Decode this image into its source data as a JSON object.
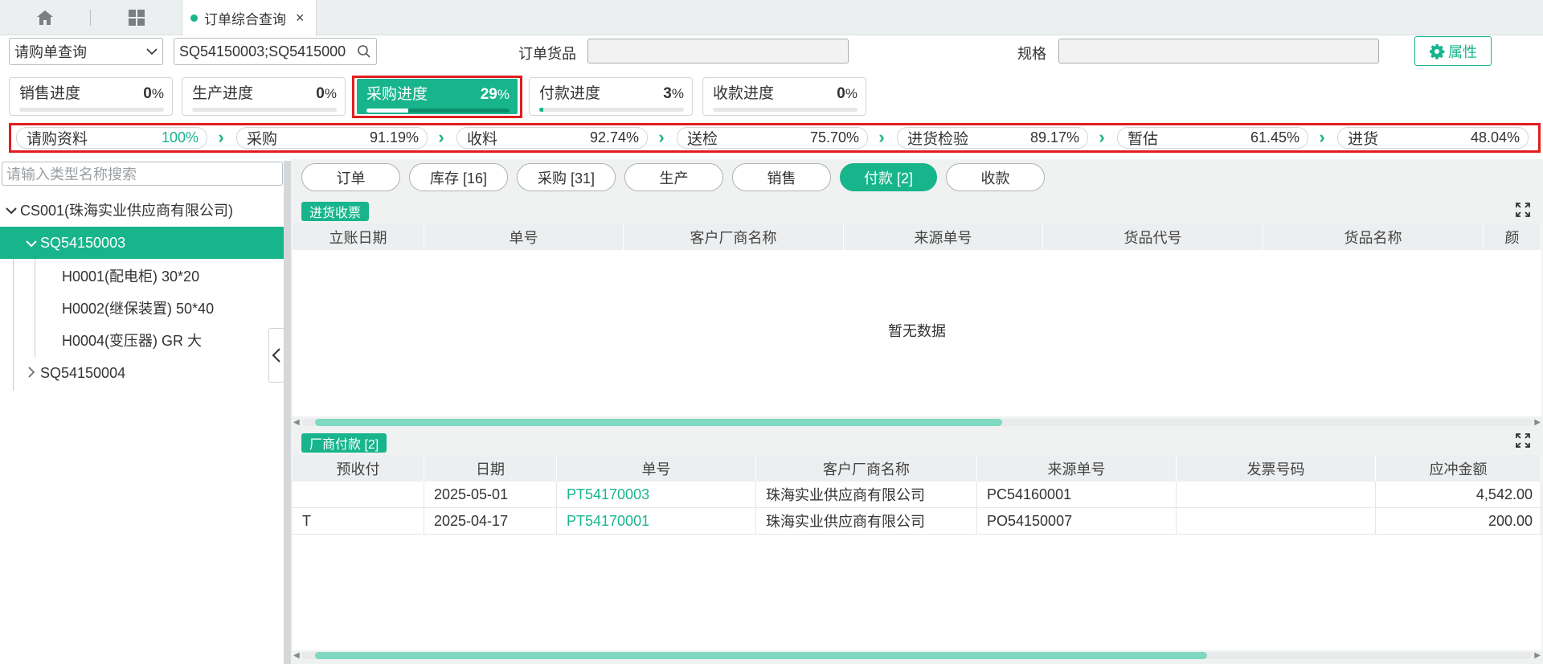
{
  "tabs": {
    "active_title": "订单综合查询",
    "close": "×"
  },
  "query": {
    "type_select": "请购单查询",
    "search_value": "SQ54150003;SQ5415000",
    "goods_label": "订单货品",
    "spec_label": "规格",
    "attr_button": "属性"
  },
  "progress": [
    {
      "label": "销售进度",
      "num": "0",
      "unit": "%",
      "value": 0
    },
    {
      "label": "生产进度",
      "num": "0",
      "unit": "%",
      "value": 0
    },
    {
      "label": "采购进度",
      "num": "29",
      "unit": "%",
      "value": 29
    },
    {
      "label": "付款进度",
      "num": "3",
      "unit": "%",
      "value": 3
    },
    {
      "label": "收款进度",
      "num": "0",
      "unit": "%",
      "value": 0
    }
  ],
  "steps": [
    {
      "label": "请购资料",
      "value": "100%"
    },
    {
      "label": "采购",
      "value": "91.19%"
    },
    {
      "label": "收料",
      "value": "92.74%"
    },
    {
      "label": "送检",
      "value": "75.70%"
    },
    {
      "label": "进货检验",
      "value": "89.17%"
    },
    {
      "label": "暂估",
      "value": "61.45%"
    },
    {
      "label": "进货",
      "value": "48.04%"
    }
  ],
  "tree": {
    "search_placeholder": "请输入类型名称搜索",
    "root": "CS001(珠海实业供应商有限公司)",
    "selected": "SQ54150003",
    "children": [
      "H0001(配电柜) 30*20",
      "H0002(继保装置) 50*40",
      "H0004(变压器) GR 大"
    ],
    "other": "SQ54150004"
  },
  "detail_tabs": [
    "订单",
    "库存 [16]",
    "采购 [31]",
    "生产",
    "销售",
    "付款 [2]",
    "收款"
  ],
  "section1": {
    "title": "进货收票",
    "columns": [
      "立账日期",
      "单号",
      "客户厂商名称",
      "来源单号",
      "货品代号",
      "货品名称",
      "颜"
    ],
    "empty": "暂无数据"
  },
  "section2": {
    "title": "厂商付款 [2]",
    "columns": [
      "预收付",
      "日期",
      "单号",
      "客户厂商名称",
      "来源单号",
      "发票号码",
      "应冲金额"
    ],
    "rows": [
      {
        "c0": "",
        "c1": "2025-05-01",
        "c2": "PT54170003",
        "c3": "珠海实业供应商有限公司",
        "c4": "PC54160001",
        "c5": "",
        "c6": "4,542.00"
      },
      {
        "c0": "T",
        "c1": "2025-04-17",
        "c2": "PT54170001",
        "c3": "珠海实业供应商有限公司",
        "c4": "PO54150007",
        "c5": "",
        "c6": "200.00"
      }
    ]
  },
  "colors": {
    "accent": "#18b58c",
    "highlight_border": "#e01e1e"
  },
  "icons": [
    "home-icon",
    "grid-icon",
    "chevron-down-icon",
    "search-icon",
    "gear-icon",
    "expand-icon",
    "chevron-left-icon",
    "chevron-right-icon"
  ]
}
